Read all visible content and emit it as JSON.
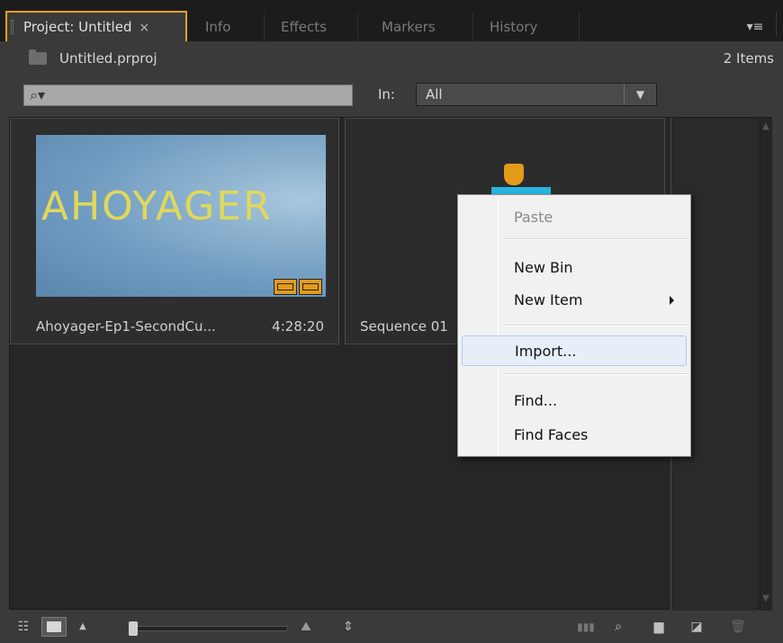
{
  "tabs": [
    {
      "label": "Project: Untitled",
      "active": true,
      "close": "×"
    },
    {
      "label": "Info"
    },
    {
      "label": "Effects"
    },
    {
      "label": "Markers"
    },
    {
      "label": "History"
    }
  ],
  "panel_menu_icon": "panel-menu-icon",
  "path": {
    "filename": "Untitled.prproj",
    "items": "2 Items"
  },
  "filter": {
    "search_icon": "⌕▾",
    "in_label": "In:",
    "in_value": "All",
    "dropdown_icon": "▼"
  },
  "items": [
    {
      "name": "Ahoyager-Ep1-SecondCu...",
      "duration": "4:28:20",
      "thumb_text": "AHOYAGER"
    },
    {
      "name": "Sequence 01"
    }
  ],
  "context_menu": {
    "paste": "Paste",
    "new_bin": "New Bin",
    "new_item": "New Item",
    "import": "Import...",
    "find": "Find...",
    "find_faces": "Find Faces"
  },
  "colors": {
    "accent": "#e8a020",
    "panel": "#3a3a3a",
    "sequence": "#29b6e0",
    "badge": "#e39b1a"
  }
}
